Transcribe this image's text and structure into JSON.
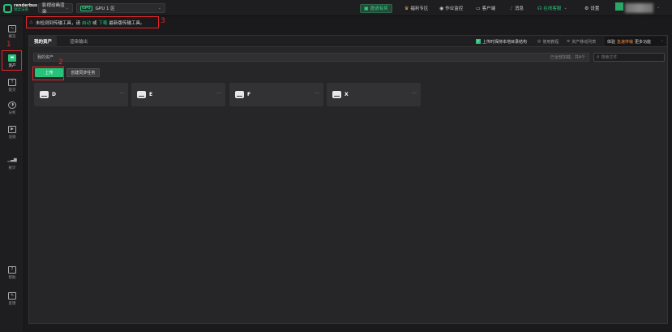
{
  "brand": {
    "name_en": "renderbus",
    "name_cn": "瑞云渲染"
  },
  "topbar": {
    "project_select": "影视动画渲染",
    "gpu_badge": "GPU",
    "gpu_select": "GPU 1 区",
    "invite": "邀请有奖",
    "welfare": "福利专区",
    "monitor": "作业监控",
    "client": "客户端",
    "messages": "消息",
    "online_service": "在线客服",
    "settings": "设置"
  },
  "sidebar": {
    "items": [
      {
        "label": "概览",
        "icon": "chart-line-icon"
      },
      {
        "label": "资产",
        "icon": "folder-icon"
      },
      {
        "label": "提交",
        "icon": "upload-icon"
      },
      {
        "label": "分析",
        "icon": "analyze-icon"
      },
      {
        "label": "渲染",
        "icon": "render-icon"
      },
      {
        "label": "统计",
        "icon": "bar-chart-icon"
      },
      {
        "label": "帮助",
        "icon": "help-doc-icon"
      },
      {
        "label": "反馈",
        "icon": "feedback-icon"
      }
    ]
  },
  "notice": {
    "text_before": "未检测到传输工具，请",
    "start_link": "启动",
    "middle": "或",
    "download_link": "下载",
    "text_after": "最新版传输工具。"
  },
  "annotations": [
    "1",
    "2",
    "3"
  ],
  "tabs": [
    {
      "label": "我的资产",
      "active": true
    },
    {
      "label": "渲染输出",
      "active": false
    }
  ],
  "toolbar": {
    "keep_structure": "上传时保持本地目录结构",
    "tutorial": "使用教程",
    "transfer_list": "资产移动列表",
    "ad_prefix": "体验",
    "ad_highlight": "急速传输",
    "ad_suffix": "更多功能"
  },
  "path": {
    "label": "我的资产",
    "count": "已全部加载，共4个"
  },
  "search": {
    "placeholder": "搜索文件"
  },
  "buttons": {
    "upload": "上传",
    "sync": "创建同步任务"
  },
  "drives": [
    "D",
    "E",
    "F",
    "X"
  ]
}
